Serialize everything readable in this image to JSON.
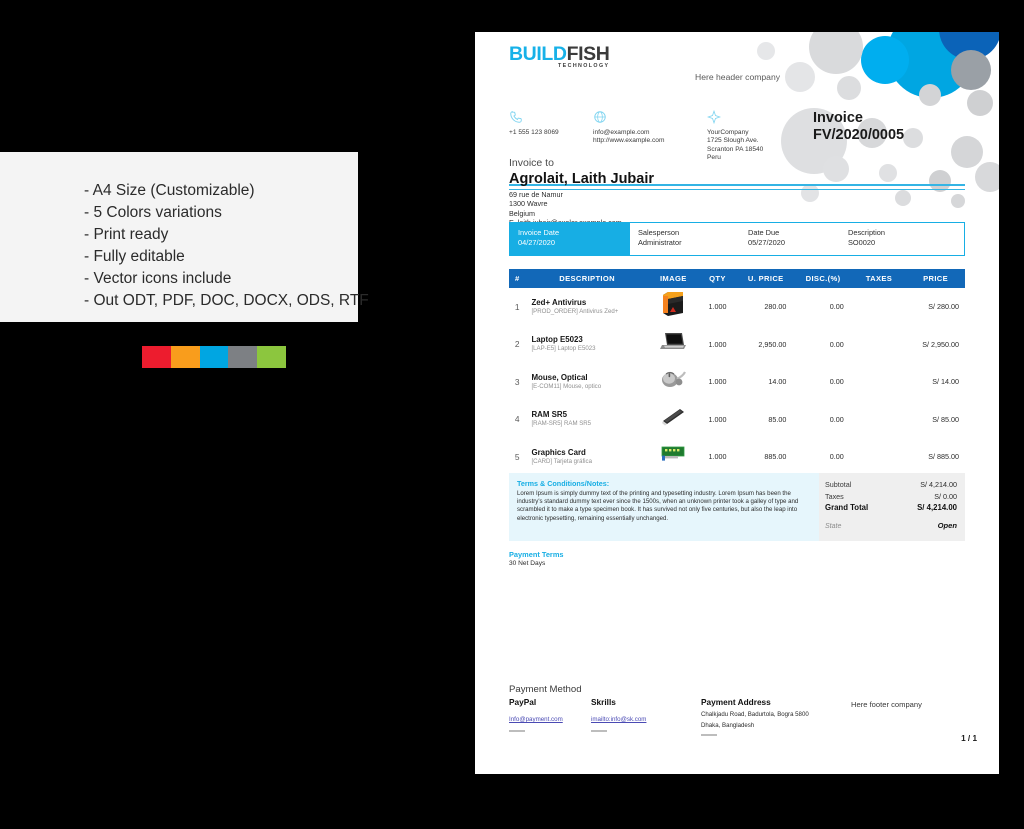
{
  "promo": {
    "features": [
      "- A4 Size (Customizable)",
      "- 5 Colors variations",
      "- Print ready",
      "- Fully editable",
      "- Vector icons include",
      "- Out ODT, PDF, DOC, DOCX, ODS, RTF"
    ],
    "swatches": [
      "#ed1c2e",
      "#f99d1c",
      "#00a6e2",
      "#7d8084",
      "#8cc63e"
    ]
  },
  "invoice": {
    "logo": {
      "part1": "BUILD",
      "part2": "FISH",
      "sub": "TECHNOLOGY"
    },
    "header_company": "Here header company",
    "contacts": {
      "phone": {
        "icon": "phone-icon",
        "text": "+1 555 123 8069"
      },
      "web": {
        "icon": "globe-icon",
        "line1": "info@example.com",
        "line2": "http://www.example.com"
      },
      "address": {
        "icon": "location-pin-icon",
        "line1": "YourCompany",
        "line2": "1725 Slough Ave.",
        "line3": "Scranton PA 18540",
        "line4": "Peru"
      }
    },
    "title": {
      "word": "Invoice",
      "number": "FV/2020/0005"
    },
    "bill_to": {
      "label": "Invoice to",
      "name": "Agrolait, Laith Jubair",
      "line1": "69 rue de Namur",
      "line2": "1300 Wavre",
      "line3": "Belgium",
      "line4": "E. laith.jubair@axelor.example.com"
    },
    "meta": {
      "invoice_date_label": "Invoice Date",
      "invoice_date_value": "04/27/2020",
      "salesperson_label": "Salesperson",
      "salesperson_value": "Administrator",
      "date_due_label": "Date Due",
      "date_due_value": "05/27/2020",
      "description_label": "Description",
      "description_value": "SO0020"
    },
    "table": {
      "columns": [
        "#",
        "DESCRIPTION",
        "IMAGE",
        "QTY",
        "U. PRICE",
        "DISC.(%)",
        "TAXES",
        "PRICE"
      ],
      "rows": [
        {
          "num": "1",
          "name": "Zed+ Antivirus",
          "code": "[PROD_ORDER] Antivirus Zed+",
          "image": "antivirus-box-thumbnail",
          "qty": "1.000",
          "unit_price": "280.00",
          "discount": "0.00",
          "taxes": "",
          "price": "S/ 280.00"
        },
        {
          "num": "2",
          "name": "Laptop E5023",
          "code": "[LAP-E5] Laptop E5023",
          "image": "laptop-thumbnail",
          "qty": "1.000",
          "unit_price": "2,950.00",
          "discount": "0.00",
          "taxes": "",
          "price": "S/ 2,950.00"
        },
        {
          "num": "3",
          "name": "Mouse, Optical",
          "code": "[E-COM11] Mouse, optico",
          "image": "mouse-thumbnail",
          "qty": "1.000",
          "unit_price": "14.00",
          "discount": "0.00",
          "taxes": "",
          "price": "S/ 14.00"
        },
        {
          "num": "4",
          "name": "RAM SR5",
          "code": "[RAM-SR5] RAM SR5",
          "image": "ram-stick-thumbnail",
          "qty": "1.000",
          "unit_price": "85.00",
          "discount": "0.00",
          "taxes": "",
          "price": "S/ 85.00"
        },
        {
          "num": "5",
          "name": "Graphics Card",
          "code": "[CARD] Tarjeta gráfica",
          "image": "graphics-card-thumbnail",
          "qty": "1.000",
          "unit_price": "885.00",
          "discount": "0.00",
          "taxes": "",
          "price": "S/ 885.00"
        }
      ]
    },
    "terms": {
      "heading": "Terms & Conditions/Notes:",
      "body": "Lorem Ipsum is simply dummy text of the printing and typesetting industry. Lorem Ipsum has been the industry's standard dummy text ever since the 1500s, when an unknown printer took a galley of type and scrambled it to make a type specimen book. It has survived not only five centuries, but also the leap into electronic typesetting, remaining essentially unchanged."
    },
    "totals": {
      "subtotal_label": "Subtotal",
      "subtotal_value": "S/ 4,214.00",
      "taxes_label": "Taxes",
      "taxes_value": "S/ 0.00",
      "grand_total_label": "Grand Total",
      "grand_total_value": "S/ 4,214.00",
      "state_label": "State",
      "state_value": "Open"
    },
    "payment_terms": {
      "heading": "Payment Terms",
      "value": "30 Net Days"
    },
    "footer": {
      "payment_method_label": "Payment Method",
      "paypal_heading": "PayPal",
      "paypal_link": "Info@payment.com",
      "skrills_heading": "Skrills",
      "skrills_link": "imailto:info@sk.com",
      "address_heading": "Payment Address",
      "address_line1": "Chalkjadu Road, Badurtola, Bogra 5800",
      "address_line2": "Dhaka, Bangladesh",
      "footer_company": "Here footer company",
      "page_number": "1 / 1"
    },
    "colors": {
      "accent_cyan": "#17aee4",
      "table_header_blue": "#1268b8",
      "terms_bg": "#e6f6fc",
      "totals_bg": "#efefef"
    }
  }
}
